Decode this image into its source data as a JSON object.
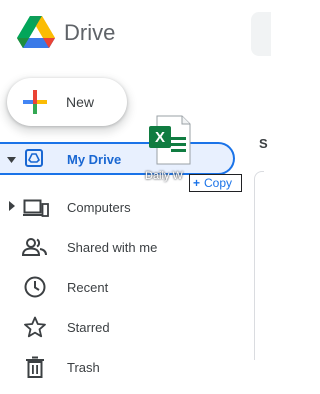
{
  "header": {
    "app_title": "Drive"
  },
  "new_button": {
    "label": "New"
  },
  "nav": {
    "items": [
      {
        "label": "My Drive",
        "icon": "my-drive-icon",
        "active": true,
        "expandable": true
      },
      {
        "label": "Computers",
        "icon": "computers-icon",
        "active": false,
        "expandable": true
      },
      {
        "label": "Shared with me",
        "icon": "shared-with-me-icon",
        "active": false,
        "expandable": false
      },
      {
        "label": "Recent",
        "icon": "clock-icon",
        "active": false,
        "expandable": false
      },
      {
        "label": "Starred",
        "icon": "star-icon",
        "active": false,
        "expandable": false
      },
      {
        "label": "Trash",
        "icon": "trash-icon",
        "active": false,
        "expandable": false
      }
    ]
  },
  "drag": {
    "file_name_partial": "Daily W",
    "file_icon": "excel-file-icon",
    "tooltip": "Copy",
    "tooltip_symbol": "+"
  },
  "right_panel": {
    "heading_partial": "S"
  },
  "colors": {
    "accent": "#1a73e8",
    "active_bg": "#e8f0fe",
    "excel_green": "#107c41"
  }
}
